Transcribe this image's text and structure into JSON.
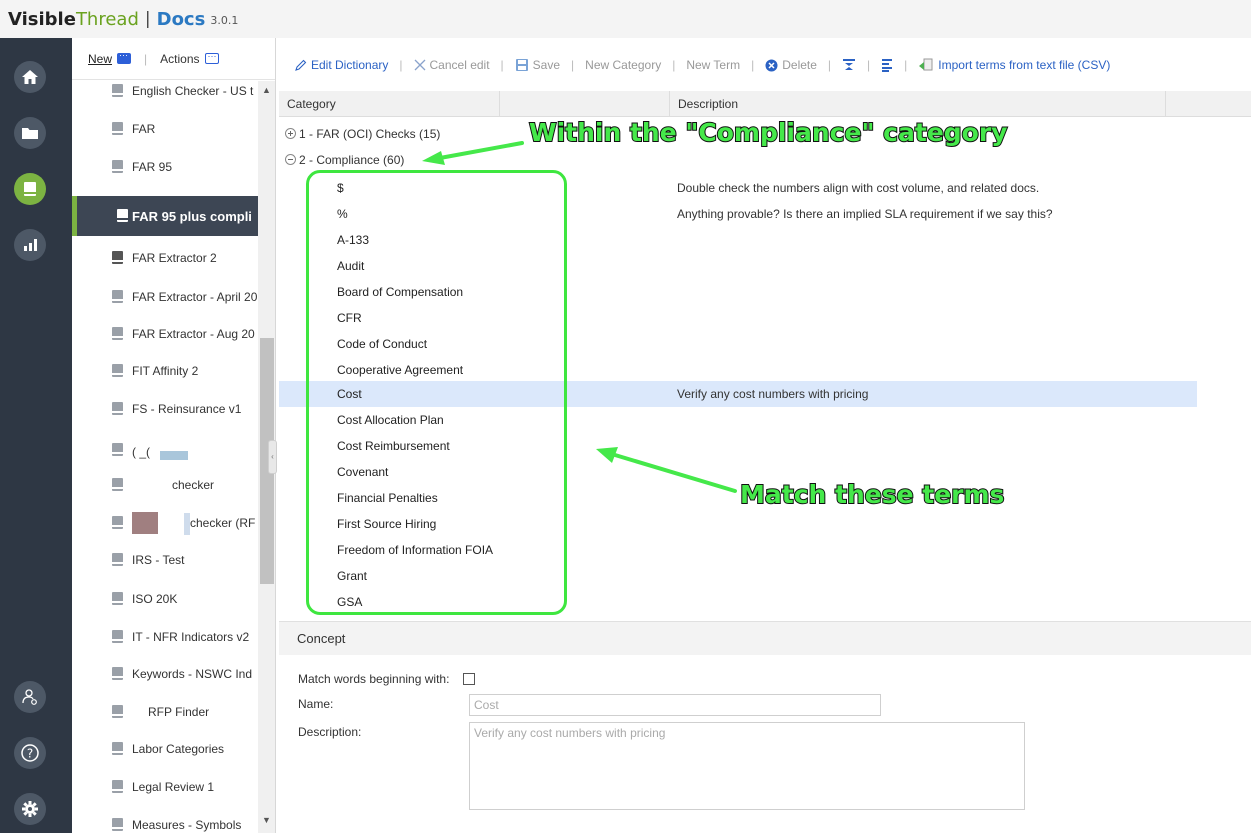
{
  "header": {
    "brand_a": "Visible",
    "brand_b": "Thread",
    "separator": "|",
    "product": "Docs",
    "version": "3.0.1"
  },
  "rail": {
    "items": [
      {
        "icon": "home-icon"
      },
      {
        "icon": "folder-icon"
      },
      {
        "icon": "dictionary-icon",
        "active": true
      },
      {
        "icon": "bar-chart-icon"
      },
      {
        "icon": "user-settings-icon"
      },
      {
        "icon": "help-icon"
      },
      {
        "icon": "gear-icon"
      }
    ],
    "active_color": "#7cb342",
    "background": "#2e3744"
  },
  "dictionary_list": {
    "new_label": "New",
    "actions_label": "Actions",
    "items": [
      {
        "label": "English Checker - US t"
      },
      {
        "label": "FAR"
      },
      {
        "label": "FAR 95"
      },
      {
        "label": "FAR 95 plus compli"
      },
      {
        "label": "FAR Extractor 2"
      },
      {
        "label": "FAR Extractor - April 20"
      },
      {
        "label": "FAR Extractor - Aug 20"
      },
      {
        "label": "FIT Affinity 2"
      },
      {
        "label": "FS - Reinsurance v1"
      },
      {
        "label": "(                    _("
      },
      {
        "label": "checker"
      },
      {
        "label": "checker (RF"
      },
      {
        "label": "IRS - Test"
      },
      {
        "label": "ISO 20K"
      },
      {
        "label": "IT - NFR Indicators v2"
      },
      {
        "label": "Keywords - NSWC Ind"
      },
      {
        "label": "RFP Finder"
      },
      {
        "label": "Labor Categories"
      },
      {
        "label": "Legal Review 1"
      },
      {
        "label": "Measures - Symbols"
      }
    ]
  },
  "toolbar": {
    "edit_dictionary": "Edit Dictionary",
    "cancel_edit": "Cancel edit",
    "save": "Save",
    "new_category": "New Category",
    "new_term": "New Term",
    "delete": "Delete",
    "import": "Import terms from text file (CSV)"
  },
  "grid": {
    "col_category": "Category",
    "col_description": "Description",
    "categories": [
      {
        "label": "1 - FAR (OCI) Checks (15)",
        "expanded": false
      },
      {
        "label": "2 - Compliance (60)",
        "expanded": true
      }
    ],
    "terms": [
      {
        "term": "$",
        "description": "Double check the numbers align with cost volume, and related docs."
      },
      {
        "term": "%",
        "description": "Anything provable? Is there an implied SLA requirement if we say this?"
      },
      {
        "term": "A-133",
        "description": ""
      },
      {
        "term": "Audit",
        "description": ""
      },
      {
        "term": "Board of Compensation",
        "description": ""
      },
      {
        "term": "CFR",
        "description": ""
      },
      {
        "term": "Code of Conduct",
        "description": ""
      },
      {
        "term": "Cooperative Agreement",
        "description": ""
      },
      {
        "term": "Cost",
        "description": "Verify any cost numbers with pricing",
        "selected": true
      },
      {
        "term": "Cost Allocation Plan",
        "description": ""
      },
      {
        "term": "Cost Reimbursement",
        "description": ""
      },
      {
        "term": "Covenant",
        "description": ""
      },
      {
        "term": "Financial Penalties",
        "description": ""
      },
      {
        "term": "First Source Hiring",
        "description": ""
      },
      {
        "term": "Freedom of Information FOIA",
        "description": ""
      },
      {
        "term": "Grant",
        "description": ""
      },
      {
        "term": "GSA",
        "description": ""
      }
    ]
  },
  "concept": {
    "title": "Concept",
    "match_label": "Match words beginning with:",
    "match_checked": false,
    "name_label": "Name:",
    "name_value": "Cost",
    "description_label": "Description:",
    "description_value": "Verify any cost numbers with pricing"
  },
  "annotations": {
    "category_note": "Within the \"Compliance\" category",
    "terms_note": "Match these terms",
    "color": "#45e84a"
  }
}
